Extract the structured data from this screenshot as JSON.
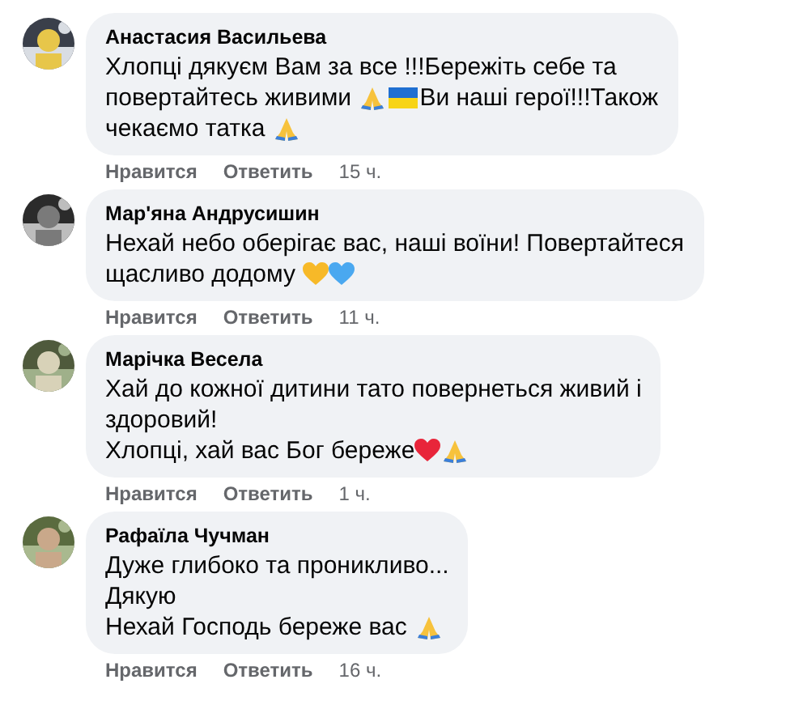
{
  "comments": [
    {
      "author": "Анастасия Васильева",
      "lines": [
        [
          {
            "kind": "text",
            "text": "Хлопці дякуєм Вам за все !!!Бережіть себе та"
          }
        ],
        [
          {
            "kind": "text",
            "text": "повертайтесь живими "
          },
          {
            "kind": "pray"
          },
          {
            "kind": "flag"
          },
          {
            "kind": "text",
            "text": "Ви наші герої!!!Також"
          }
        ],
        [
          {
            "kind": "text",
            "text": "чекаємо татка "
          },
          {
            "kind": "pray"
          }
        ]
      ],
      "actions": [
        "Нравится",
        "Ответить"
      ],
      "time": "15 ч."
    },
    {
      "author": "Мар'яна Андрусишин",
      "lines": [
        [
          {
            "kind": "text",
            "text": "Нехай небо оберігає вас, наші воїни! Повертайтеся"
          }
        ],
        [
          {
            "kind": "text",
            "text": "щасливо додому "
          },
          {
            "kind": "heart",
            "color": "#f7b928"
          },
          {
            "kind": "heart",
            "color": "#4aa8f0"
          }
        ]
      ],
      "actions": [
        "Нравится",
        "Ответить"
      ],
      "time": "11 ч."
    },
    {
      "author": "Марічка Весела",
      "lines": [
        [
          {
            "kind": "text",
            "text": "Хай до кожної дитини тато повернеться живий і"
          }
        ],
        [
          {
            "kind": "text",
            "text": "здоровий!"
          }
        ],
        [
          {
            "kind": "text",
            "text": "Хлопці, хай вас Бог береже"
          },
          {
            "kind": "heart",
            "color": "#e8253a"
          },
          {
            "kind": "pray"
          }
        ]
      ],
      "actions": [
        "Нравится",
        "Ответить"
      ],
      "time": "1 ч."
    },
    {
      "author": "Рафаїла Чучман",
      "lines": [
        [
          {
            "kind": "text",
            "text": "Дуже глибоко та проникливо..."
          }
        ],
        [
          {
            "kind": "text",
            "text": "Дякую"
          }
        ],
        [
          {
            "kind": "text",
            "text": "Нехай Господь береже вас "
          },
          {
            "kind": "pray"
          }
        ]
      ],
      "actions": [
        "Нравится",
        "Ответить"
      ],
      "time": "16 ч."
    }
  ]
}
